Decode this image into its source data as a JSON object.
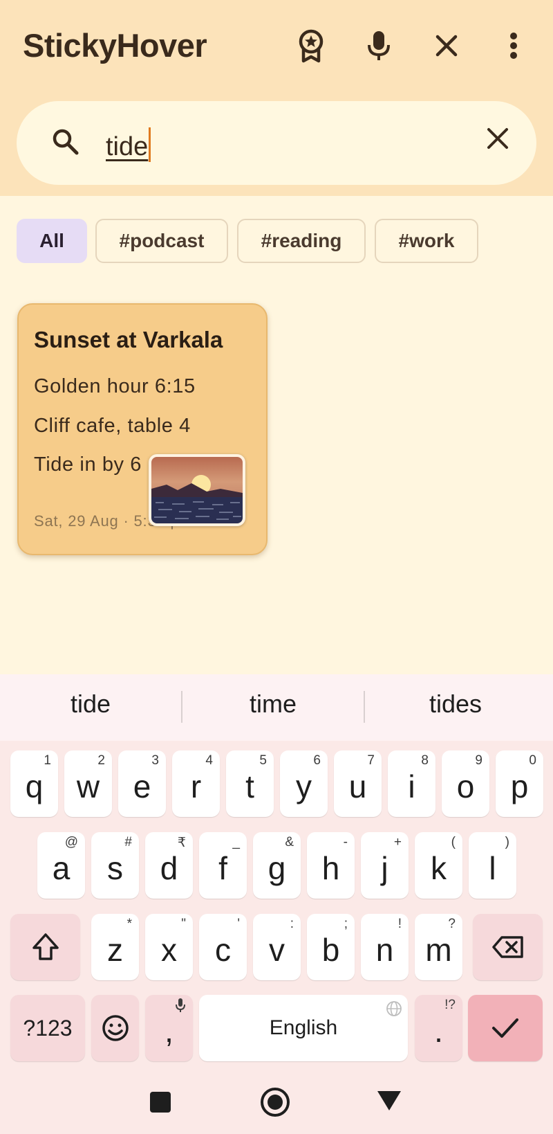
{
  "app": {
    "title": "StickyHover"
  },
  "toolbar": {
    "icons": [
      "badge-star-icon",
      "microphone-icon",
      "close-icon",
      "more-vertical-icon"
    ]
  },
  "search": {
    "value": "tide",
    "placeholder": ""
  },
  "filters": [
    {
      "label": "All",
      "active": true
    },
    {
      "label": "#podcast",
      "active": false
    },
    {
      "label": "#reading",
      "active": false
    },
    {
      "label": "#work",
      "active": false
    }
  ],
  "notes": [
    {
      "title": "Sunset at Varkala",
      "lines": [
        "Golden hour 6:15",
        "Cliff cafe, table 4",
        "Tide in by 6"
      ],
      "date": "Sat, 29 Aug · 5:34 pm",
      "color": "#F6CC8A"
    }
  ],
  "keyboard": {
    "suggestions": [
      "tide",
      "time",
      "tides"
    ],
    "row1": [
      {
        "k": "q",
        "s": "1"
      },
      {
        "k": "w",
        "s": "2"
      },
      {
        "k": "e",
        "s": "3"
      },
      {
        "k": "r",
        "s": "4"
      },
      {
        "k": "t",
        "s": "5"
      },
      {
        "k": "y",
        "s": "6"
      },
      {
        "k": "u",
        "s": "7"
      },
      {
        "k": "i",
        "s": "8"
      },
      {
        "k": "o",
        "s": "9"
      },
      {
        "k": "p",
        "s": "0"
      }
    ],
    "row2": [
      {
        "k": "a",
        "s": "@"
      },
      {
        "k": "s",
        "s": "#"
      },
      {
        "k": "d",
        "s": "₹"
      },
      {
        "k": "f",
        "s": "_"
      },
      {
        "k": "g",
        "s": "&"
      },
      {
        "k": "h",
        "s": "-"
      },
      {
        "k": "j",
        "s": "+"
      },
      {
        "k": "k",
        "s": "("
      },
      {
        "k": "l",
        "s": ")"
      }
    ],
    "row3": [
      {
        "k": "z",
        "s": "*"
      },
      {
        "k": "x",
        "s": "\""
      },
      {
        "k": "c",
        "s": "'"
      },
      {
        "k": "v",
        "s": ":"
      },
      {
        "k": "b",
        "s": ";"
      },
      {
        "k": "n",
        "s": "!"
      },
      {
        "k": "m",
        "s": "?"
      }
    ],
    "symbols_label": "?123",
    "comma": ",",
    "space_label": "English",
    "period": ".",
    "period_sub": "!?"
  },
  "colors": {
    "accent": "#E07A1F",
    "topbar": "#FCE3BA",
    "background": "#FFF6DF",
    "chip_active": "#E6DCF5",
    "note": "#F6CC8A",
    "enter_key": "#F2B1B8"
  }
}
